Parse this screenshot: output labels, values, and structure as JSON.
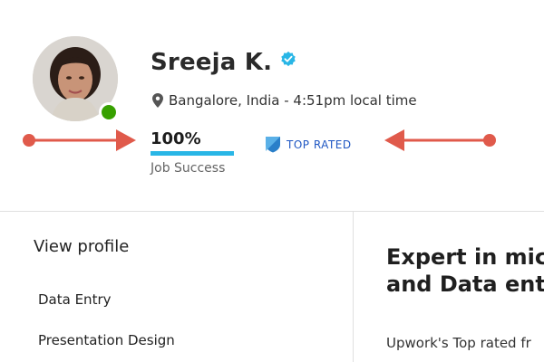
{
  "profile": {
    "name": "Sreeja K.",
    "location": "Bangalore, India - 4:51pm local time",
    "job_success": {
      "value_label": "100%",
      "percent": 100,
      "label": "Job Success"
    },
    "badge": "TOP RATED",
    "online": true
  },
  "sidebar": {
    "view_profile": "View profile",
    "skills": [
      "Data Entry",
      "Presentation Design"
    ]
  },
  "main": {
    "headline": "Expert in mic\nand Data ent",
    "description": "Upwork's Top rated fr"
  },
  "icons": {
    "verified": "verified-check-icon",
    "location": "map-pin-icon",
    "badge": "top-rated-badge-icon"
  },
  "colors": {
    "accent_blue": "#29b6e6",
    "badge_text": "#1f57c3",
    "online_green": "#37a000",
    "annotation_red": "#e05a4b"
  }
}
